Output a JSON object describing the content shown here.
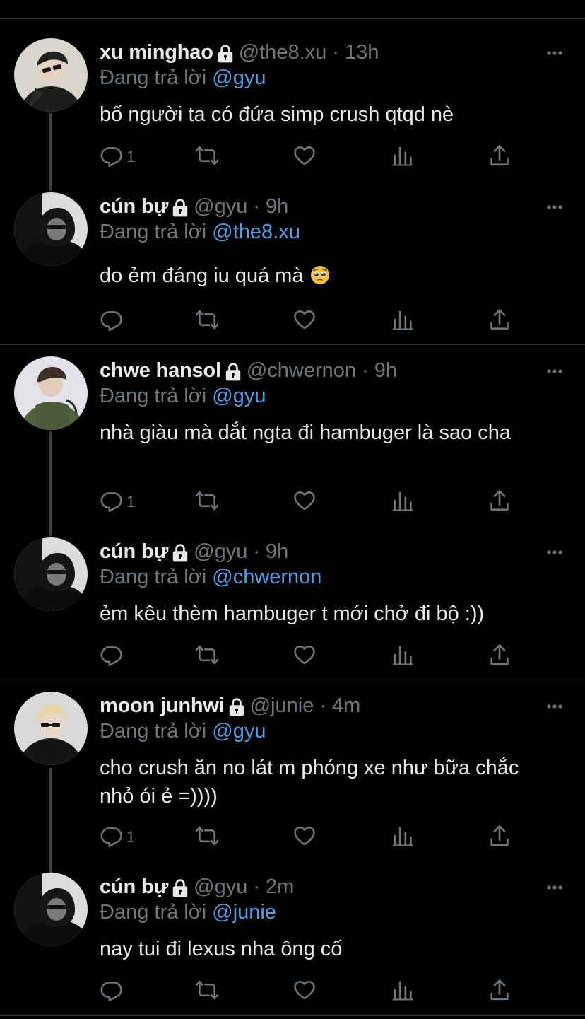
{
  "tweets": [
    {
      "name": "xu minghao",
      "handle": "@the8.xu",
      "time": "13h",
      "reply_prefix": "Đang trả lời ",
      "reply_to": "@gyu",
      "text": "bố người ta có đứa simp crush qtqd nè",
      "reply_count": "1",
      "avatar": "light"
    },
    {
      "name": "cún bự",
      "handle": "@gyu",
      "time": "9h",
      "reply_prefix": "Đang trả lời ",
      "reply_to": "@the8.xu",
      "text": "do ẻm đáng iu quá mà ",
      "reply_count": "",
      "avatar": "dark",
      "emoji": "pleading-face"
    },
    {
      "name": "chwe hansol",
      "handle": "@chwernon",
      "time": "9h",
      "reply_prefix": "Đang trả lời ",
      "reply_to": "@gyu",
      "text": "nhà giàu mà dắt ngta đi hambuger là sao cha",
      "reply_count": "1",
      "avatar": "green"
    },
    {
      "name": "cún bự",
      "handle": "@gyu",
      "time": "9h",
      "reply_prefix": "Đang trả lời ",
      "reply_to": "@chwernon",
      "text": "ẻm kêu thèm hambuger t mới chở đi bộ :))",
      "reply_count": "",
      "avatar": "dark"
    },
    {
      "name": "moon junhwi",
      "handle": "@junie",
      "time": "4m",
      "reply_prefix": "Đang trả lời ",
      "reply_to": "@gyu",
      "text": "cho crush ăn no lát m phóng xe như bữa chắc nhỏ ói ẻ =))))",
      "reply_count": "1",
      "avatar": "blond"
    },
    {
      "name": "cún bự",
      "handle": "@gyu",
      "time": "2m",
      "reply_prefix": "Đang trả lời ",
      "reply_to": "@junie",
      "text": "nay tui đi lexus nha ông cố",
      "reply_count": "",
      "avatar": "dark"
    }
  ],
  "separator": "·",
  "colors": {
    "background": "#000000",
    "text": "#e7e9ea",
    "muted": "#71767b",
    "mention": "#4e9fe6",
    "divider": "#2f3336"
  },
  "icons": [
    "lock-icon",
    "more-icon",
    "reply-icon",
    "retweet-icon",
    "like-icon",
    "views-icon",
    "share-icon"
  ]
}
